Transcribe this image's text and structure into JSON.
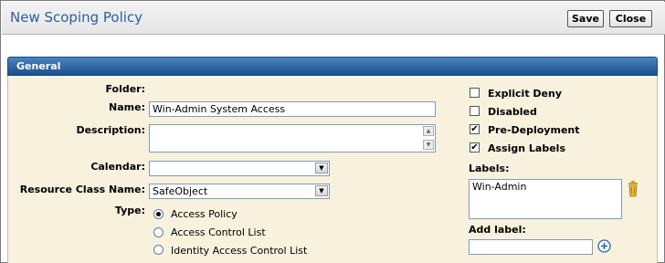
{
  "window": {
    "title": "New Scoping Policy",
    "save_label": "Save",
    "close_label": "Close"
  },
  "section": {
    "title": "General"
  },
  "form": {
    "folder_label": "Folder:",
    "name_label": "Name:",
    "name_value": "Win-Admin System Access",
    "description_label": "Description:",
    "description_value": "",
    "calendar_label": "Calendar:",
    "calendar_value": "",
    "resource_class_label": "Resource Class Name:",
    "resource_class_value": "SafeObject",
    "type_label": "Type:",
    "type_options": [
      {
        "label": "Access Policy",
        "selected": true
      },
      {
        "label": "Access Control List",
        "selected": false
      },
      {
        "label": "Identity Access Control List",
        "selected": false
      }
    ]
  },
  "options": {
    "checkboxes": [
      {
        "label": "Explicit Deny",
        "checked": false
      },
      {
        "label": "Disabled",
        "checked": false
      },
      {
        "label": "Pre-Deployment",
        "checked": true
      },
      {
        "label": "Assign Labels",
        "checked": true
      }
    ],
    "labels_label": "Labels:",
    "labels_items": [
      "Win-Admin"
    ],
    "add_label_label": "Add label:",
    "add_label_value": "",
    "check_mark": "✔"
  },
  "colors": {
    "title_text": "#2d5f9e",
    "section_header": "#1b4f8e",
    "panel_bg": "#f8f1dd"
  },
  "icons": {
    "trash": "trash-icon",
    "add": "plus-circle-icon"
  }
}
